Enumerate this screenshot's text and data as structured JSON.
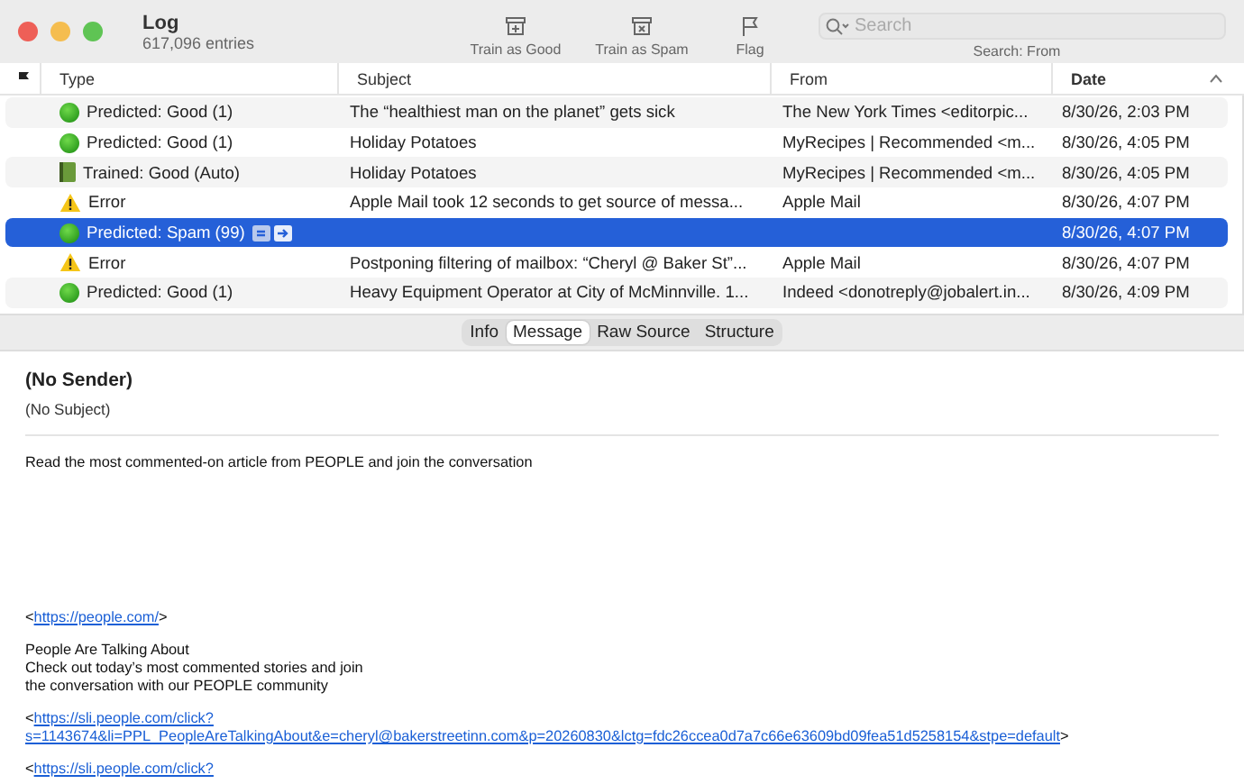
{
  "window": {
    "title": "Log",
    "subtitle": "617,096 entries"
  },
  "toolbar": {
    "buttons": [
      {
        "kind": "good",
        "label": "Train as Good"
      },
      {
        "kind": "spam",
        "label": "Train as Spam"
      },
      {
        "kind": "flag",
        "label": "Flag"
      }
    ],
    "search": {
      "placeholder": "Search",
      "scope": "Search: From"
    }
  },
  "table": {
    "columns": [
      {
        "label": "Type",
        "sorted": false
      },
      {
        "label": "Subject",
        "sorted": false
      },
      {
        "label": "From",
        "sorted": false
      },
      {
        "label": "Date",
        "sorted": true
      }
    ],
    "rows": [
      {
        "kind": "good",
        "type": "Predicted: Good (1)",
        "subject": "The “healthiest man on the planet” gets sick",
        "from": "The New York Times <editorpic...",
        "date": "8/30/26, 2:03 PM",
        "selected": false,
        "action_icons": false
      },
      {
        "kind": "good",
        "type": "Predicted: Good (1)",
        "subject": "Holiday Potatoes",
        "from": "MyRecipes | Recommended <m...",
        "date": "8/30/26, 4:05 PM",
        "selected": false,
        "action_icons": false
      },
      {
        "kind": "trained",
        "type": "Trained: Good (Auto)",
        "subject": "Holiday Potatoes",
        "from": "MyRecipes | Recommended <m...",
        "date": "8/30/26, 4:05 PM",
        "selected": false,
        "action_icons": false
      },
      {
        "kind": "error",
        "type": "Error",
        "subject": "Apple Mail took 12 seconds to get source of messa...",
        "from": "Apple Mail",
        "date": "8/30/26, 4:07 PM",
        "selected": false,
        "action_icons": false
      },
      {
        "kind": "good",
        "type": "Predicted: Spam (99)",
        "subject": "",
        "from": "",
        "date": "8/30/26, 4:07 PM",
        "selected": true,
        "action_icons": true
      },
      {
        "kind": "error",
        "type": "Error",
        "subject": "Postponing filtering of mailbox: “Cheryl @ Baker St”...",
        "from": "Apple Mail",
        "date": "8/30/26, 4:07 PM",
        "selected": false,
        "action_icons": false
      },
      {
        "kind": "good",
        "type": "Predicted: Good (1)",
        "subject": "Heavy Equipment Operator at City of McMinnville. 1...",
        "from": "Indeed <donotreply@jobalert.in...",
        "date": "8/30/26, 4:09 PM",
        "selected": false,
        "action_icons": false
      }
    ]
  },
  "detail_tabs": [
    {
      "label": "Info",
      "selected": false
    },
    {
      "label": "Message",
      "selected": true
    },
    {
      "label": "Raw Source",
      "selected": false
    },
    {
      "label": "Structure",
      "selected": false
    }
  ],
  "message": {
    "sender": "(No Sender)",
    "subject": "(No Subject)",
    "body": [
      {
        "kind": "text",
        "lines": [
          "Read the most commented-on article from PEOPLE and join the conversation"
        ]
      },
      {
        "kind": "link",
        "before": "<",
        "url_lines": [
          "https://people.com/"
        ],
        "after": ">"
      },
      {
        "kind": "text",
        "lines": [
          "People Are Talking About",
          "Check out today’s most commented stories and join",
          "the conversation with our PEOPLE community"
        ]
      },
      {
        "kind": "link",
        "before": "<",
        "url_lines": [
          "https://sli.people.com/click?",
          "s=1143674&li=PPL_PeopleAreTalkingAbout&e=cheryl@bakerstreetinn.com&p=20260830&lctg=fdc26ccea0d7a7c66e63609bd09fea51d5258154&stpe=default"
        ],
        "after": ">"
      },
      {
        "kind": "link",
        "before": "<",
        "url_lines": [
          "https://sli.people.com/click?"
        ]
      }
    ]
  }
}
